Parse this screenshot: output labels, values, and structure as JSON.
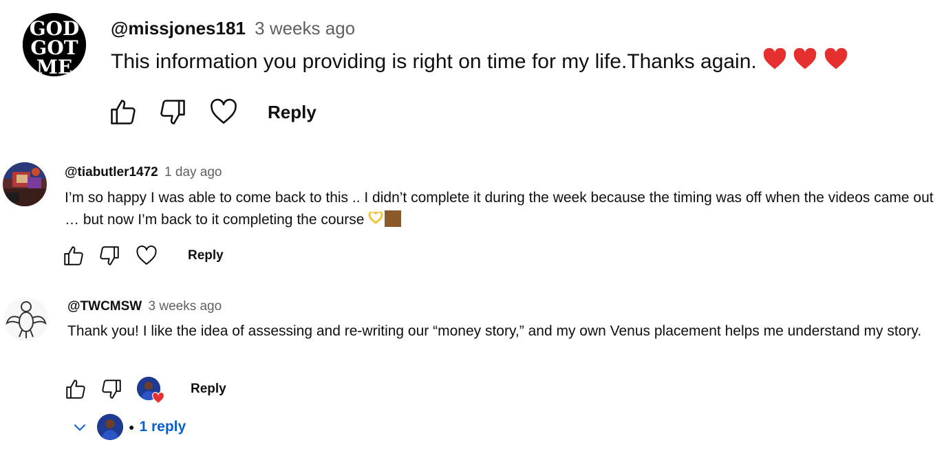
{
  "comments": [
    {
      "author": "@missjones181",
      "time": "3 weeks ago",
      "text": "This information you providing is right on time for my life.Thanks again.",
      "emoji": [
        "red-heart",
        "red-heart",
        "red-heart"
      ],
      "avatar_text": [
        "GOD",
        "GOT",
        "ME"
      ],
      "reply_label": "Reply"
    },
    {
      "author": "@tiabutler1472",
      "time": "1 day ago",
      "text": "I’m so happy I was able to come back to this .. I didn’t complete it during the week because the timing was off when the videos came out … but now I’m back to it completing the course",
      "emoji": [
        "heart-hands",
        "brown-square"
      ],
      "reply_label": "Reply"
    },
    {
      "author": "@TWCMSW",
      "time": "3 weeks ago",
      "text": "Thank you! I like the idea of assessing and re-writing our “money story,” and my own Venus placement helps me understand my story.",
      "reply_label": "Reply",
      "creator_hearted": true
    }
  ],
  "replies_toggle": {
    "count_label": "1 reply"
  },
  "colors": {
    "link": "#065fd4",
    "heart": "#e5302f",
    "meta": "#606060"
  },
  "icons": [
    "thumbs-up-icon",
    "thumbs-down-icon",
    "heart-outline-icon",
    "chevron-down-icon"
  ]
}
